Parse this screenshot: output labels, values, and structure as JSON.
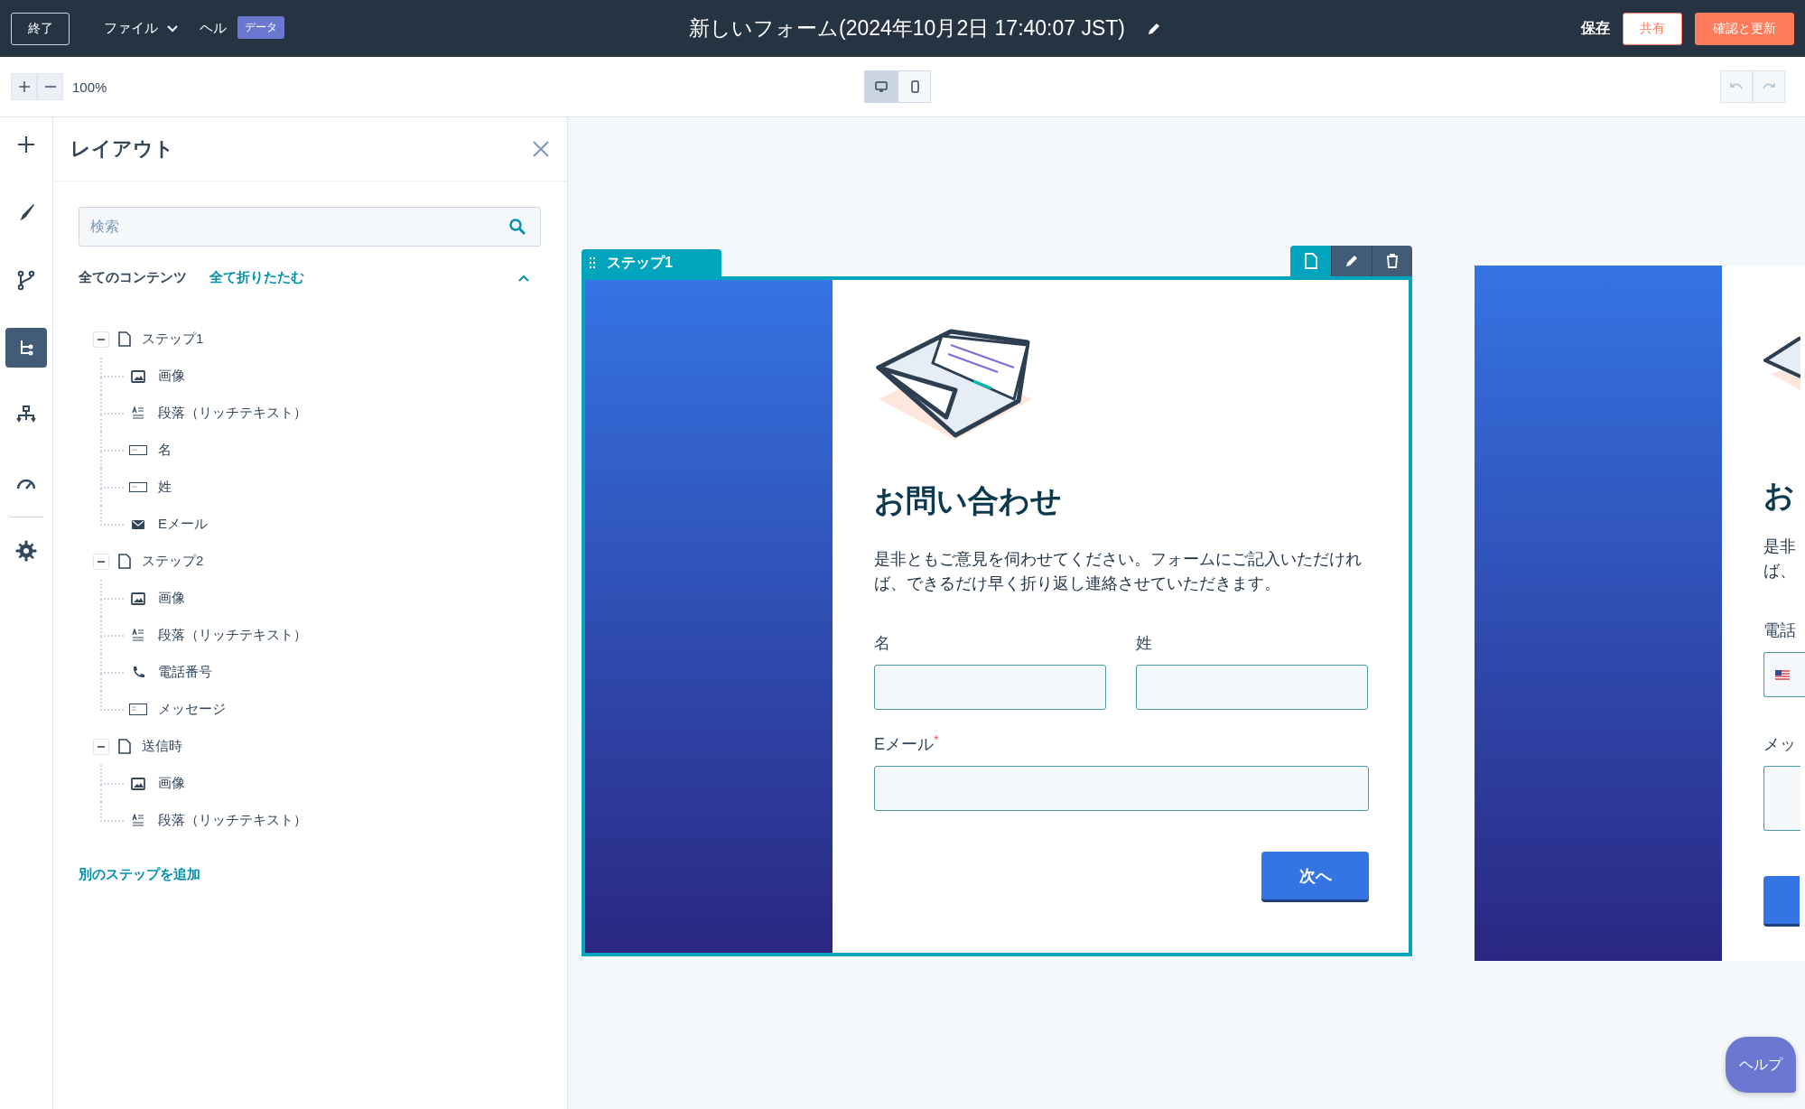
{
  "topbar": {
    "exit_button": "終了",
    "menus": [
      {
        "label": "ファイル",
        "caret": true
      },
      {
        "label": "ヘル",
        "caret": false
      }
    ],
    "badge": "データ",
    "title": "新しいフォーム(2024年10月2日 17:40:07 JST)",
    "save": "保存",
    "share": "共有",
    "publish": "確認と更新"
  },
  "toolbar": {
    "zoom": "100%",
    "views": [
      {
        "kind": "desktop",
        "selected": true
      },
      {
        "kind": "mobile",
        "selected": false
      }
    ]
  },
  "rail": [
    {
      "kind": "add",
      "selected": false
    },
    {
      "kind": "brush",
      "selected": false
    },
    {
      "kind": "branch",
      "selected": false
    },
    {
      "kind": "tree",
      "selected": true
    },
    {
      "kind": "hierarchy",
      "selected": false
    },
    {
      "kind": "gauge",
      "selected": false
    },
    {
      "kind": "settings",
      "selected": false
    }
  ],
  "panel": {
    "title": "レイアウト",
    "search": {
      "placeholder": "検索"
    },
    "section": "全てのコンテンツ",
    "collapse_all": "全て折りたたむ",
    "expanded": true,
    "tree": [
      {
        "label": "ステップ1",
        "expanded": true,
        "children": [
          {
            "label": "画像",
            "kind": "image"
          },
          {
            "label": "段落（リッチテキスト）",
            "kind": "text"
          },
          {
            "label": "名",
            "kind": "field"
          },
          {
            "label": "姓",
            "kind": "field"
          },
          {
            "label": "Eメール",
            "kind": "email"
          }
        ]
      },
      {
        "label": "ステップ2",
        "expanded": true,
        "children": [
          {
            "label": "画像",
            "kind": "image"
          },
          {
            "label": "段落（リッチテキスト）",
            "kind": "text"
          },
          {
            "label": "電話番号",
            "kind": "phone"
          },
          {
            "label": "メッセージ",
            "kind": "textarea"
          }
        ]
      },
      {
        "label": "送信時",
        "expanded": true,
        "children": [
          {
            "label": "画像",
            "kind": "image"
          },
          {
            "label": "段落（リッチテキスト）",
            "kind": "text"
          }
        ]
      }
    ],
    "add_step": "別のステップを追加"
  },
  "step": {
    "tab": "ステップ1",
    "selected": true,
    "heading": "お問い合わせ",
    "description": "是非ともご意見を伺わせてください。フォームにご記入いただければ、できるだけ早く折り返し連絡させていただきます。",
    "fields": [
      {
        "label": "名"
      },
      {
        "label": "姓"
      }
    ],
    "email": {
      "label": "Eメール",
      "required_mark": "*"
    },
    "button": "次へ"
  },
  "next_step": {
    "heading": "お",
    "description": [
      "是非",
      "ば、"
    ],
    "phone_label": "電話",
    "message_label": "メッ"
  },
  "help": "ヘルプ"
}
